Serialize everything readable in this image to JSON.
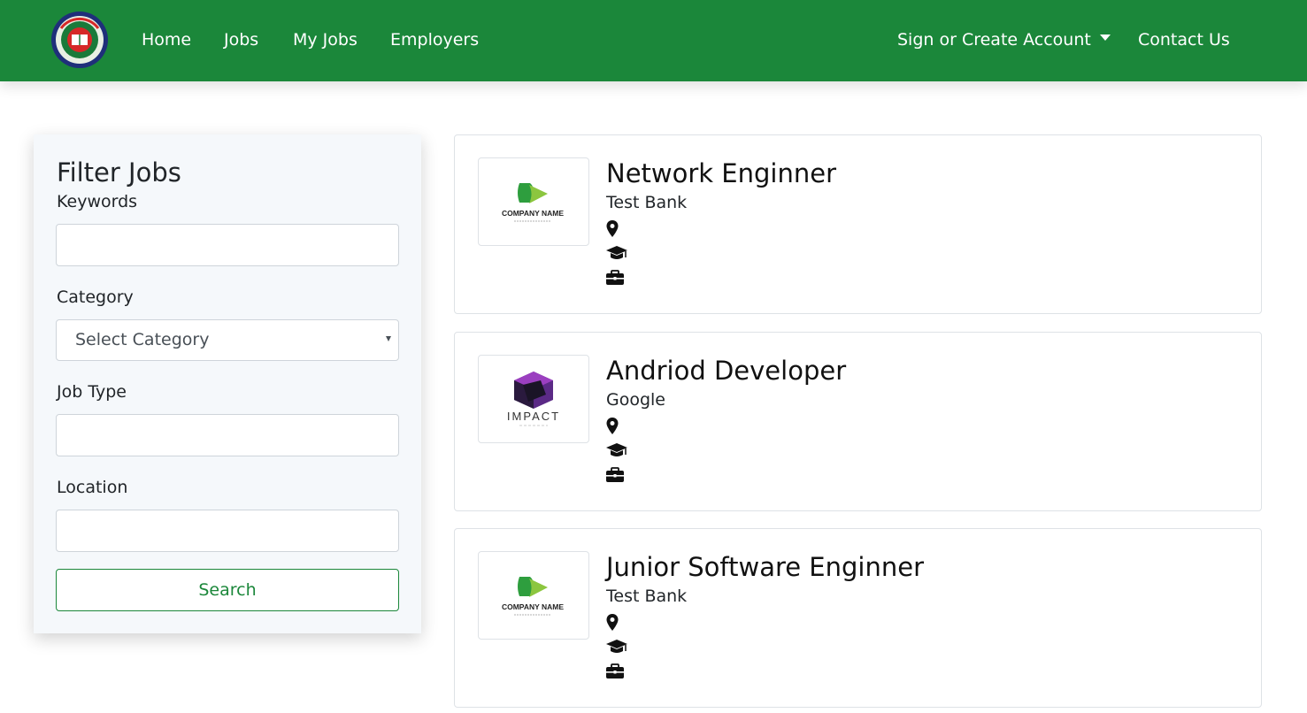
{
  "nav": {
    "logo_icon": "bcs-emblem-logo-icon",
    "home": "Home",
    "jobs": "Jobs",
    "my_jobs": "My Jobs",
    "employers": "Employers",
    "sign_in": "Sign or Create Account",
    "contact": "Contact Us",
    "background_color": "#1b873a"
  },
  "filter": {
    "title": "Filter Jobs",
    "keywords_label": "Keywords",
    "keywords_value": "",
    "category_label": "Category",
    "category_selected": "Select Category",
    "job_type_label": "Job Type",
    "job_type_value": "",
    "location_label": "Location",
    "location_value": "",
    "search_button": "Search"
  },
  "jobs": [
    {
      "title": "Network Enginner",
      "company": "Test Bank",
      "logo": "company-name-logo-icon",
      "logo_text": "COMPANY NAME"
    },
    {
      "title": "Andriod Developer",
      "company": "Google",
      "logo": "impact-build-logo-icon",
      "logo_text": "IMPACT"
    },
    {
      "title": "Junior Software Enginner",
      "company": "Test Bank",
      "logo": "company-name-logo-icon",
      "logo_text": "COMPANY NAME"
    }
  ],
  "meta_icons": [
    "map-marker-icon",
    "graduation-cap-icon",
    "briefcase-icon"
  ],
  "colors": {
    "brand_green": "#1b873a",
    "panel_bg": "#f5f8fb"
  }
}
